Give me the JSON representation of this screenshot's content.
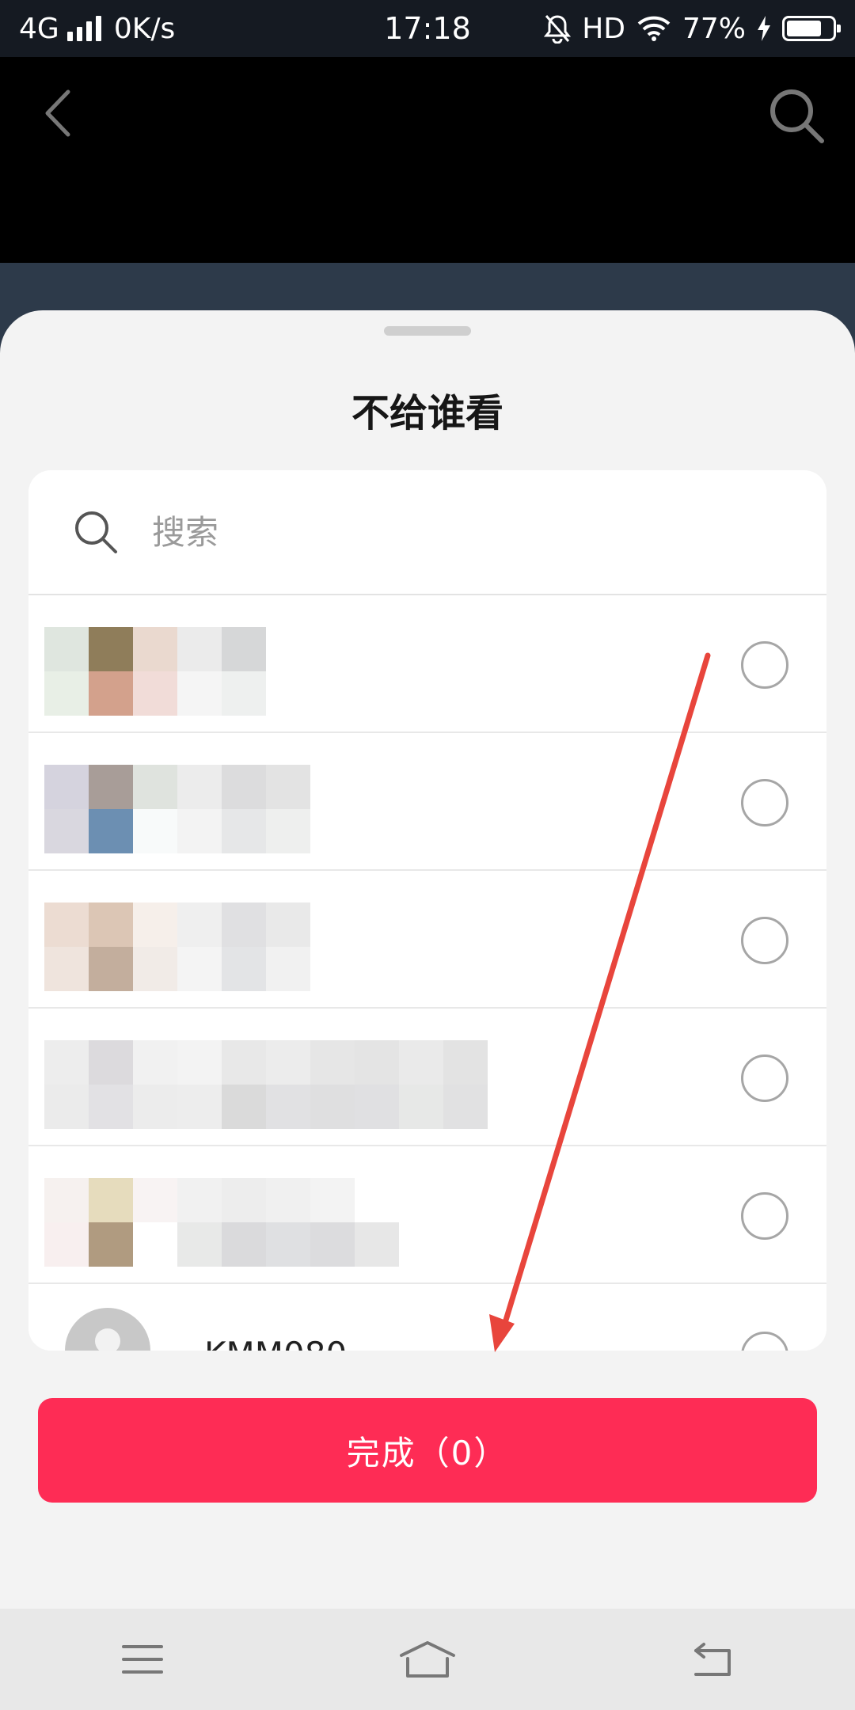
{
  "status_bar": {
    "network": "4G",
    "speed": "0K/s",
    "time": "17:18",
    "hd": "HD",
    "battery": "77%",
    "battery_level": 0.77
  },
  "icons": {
    "back": "chevron-left-icon",
    "search": "search-icon",
    "radio": "radio-unchecked-icon"
  },
  "sheet": {
    "title": "不给谁看",
    "search_placeholder": "搜索",
    "contacts": [
      {
        "name": "",
        "selected": false
      },
      {
        "name": "",
        "selected": false
      },
      {
        "name": "",
        "selected": false
      },
      {
        "name": "",
        "selected": false
      },
      {
        "name": "",
        "selected": false
      },
      {
        "name": "KMM080",
        "selected": false
      }
    ],
    "done_label": "完成（0）"
  },
  "colors": {
    "accent": "#fe2c55",
    "annotation": "#e8453c"
  }
}
